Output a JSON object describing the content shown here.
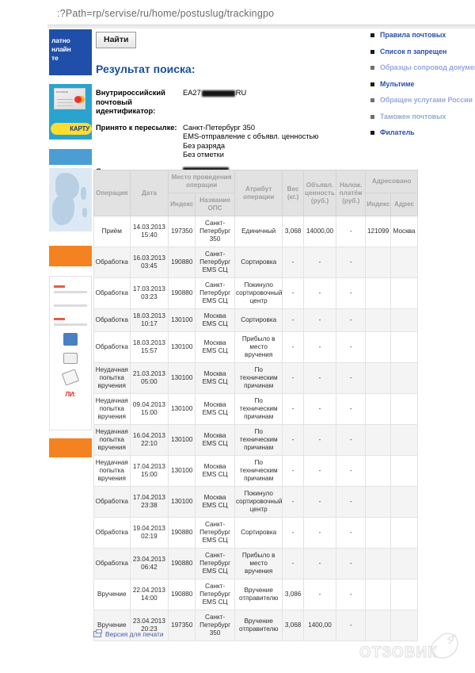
{
  "browser": {
    "url_fragment": ":?Path=rp/servise/ru/home/postuslug/trackingpo"
  },
  "toolbar": {
    "find_label": "Найти"
  },
  "result": {
    "title": "Результат поиска:",
    "id_label_line1": "Внутрироссийский",
    "id_label_line2": "почтовый идентификатор:",
    "id_prefix": "EA27",
    "id_suffix": "RU",
    "accepted_label": "Принято к пересылке:",
    "accepted_values": [
      "Санкт-Петербург 350",
      "EMS-отправление с объявл. ценностью",
      "Без разряда",
      "Без отметки"
    ],
    "sender_label": "Отправитель:"
  },
  "table": {
    "headers": {
      "operation": "Операция",
      "date": "Дата",
      "place_group": "Место проведения операции",
      "index": "Индекс",
      "ops_name": "Название ОПС",
      "attribute": "Атрибут операции",
      "weight": "Вес (кг.)",
      "declared_value": "Объявл. ценность (руб.)",
      "cod": "Налож. платёж (руб.)",
      "addressed_group": "Адресовано",
      "addr_index": "Индекс",
      "addr_address": "Адрес"
    },
    "rows": [
      {
        "operation": "Приём",
        "date": "14.03.2013 15:40",
        "index": "197350",
        "index_link": false,
        "ops": "Санкт-Петербург 350",
        "attribute": "Единичный",
        "weight": "3,068",
        "value": "14000,00",
        "cod": "-",
        "addr_index": "121099",
        "addr": "Москва"
      },
      {
        "operation": "Обработка",
        "date": "16.03.2013 03:45",
        "index": "190880",
        "index_link": false,
        "ops": "Санкт-Петербург EMS СЦ",
        "attribute": "Сортировка",
        "weight": "-",
        "value": "-",
        "cod": "-",
        "addr_index": "",
        "addr": ""
      },
      {
        "operation": "Обработка",
        "date": "17.03.2013 03:23",
        "index": "190880",
        "index_link": false,
        "ops": "Санкт-Петербург EMS СЦ",
        "attribute": "Покинуло сортировочный центр",
        "weight": "-",
        "value": "-",
        "cod": "-",
        "addr_index": "",
        "addr": ""
      },
      {
        "operation": "Обработка",
        "date": "18.03.2013 10:17",
        "index": "130100",
        "index_link": false,
        "ops": "Москва EMS СЦ",
        "attribute": "Сортировка",
        "weight": "-",
        "value": "-",
        "cod": "-",
        "addr_index": "",
        "addr": ""
      },
      {
        "operation": "Обработка",
        "date": "18.03.2013 15:57",
        "index": "130100",
        "index_link": false,
        "ops": "Москва EMS СЦ",
        "attribute": "Прибыло в место вручения",
        "weight": "-",
        "value": "-",
        "cod": "-",
        "addr_index": "",
        "addr": ""
      },
      {
        "operation": "Неудачная попытка вручения",
        "date": "21.03.2013 05:00",
        "index": "130100",
        "index_link": false,
        "ops": "Москва EMS СЦ",
        "attribute": "По техническим причинам",
        "weight": "-",
        "value": "-",
        "cod": "-",
        "addr_index": "",
        "addr": ""
      },
      {
        "operation": "Неудачная попытка вручения",
        "date": "09.04.2013 15:00",
        "index": "130100",
        "index_link": false,
        "ops": "Москва EMS СЦ",
        "attribute": "По техническим причинам",
        "weight": "-",
        "value": "-",
        "cod": "-",
        "addr_index": "",
        "addr": ""
      },
      {
        "operation": "Неудачная попытка вручения",
        "date": "16.04.2013 22:10",
        "index": "130100",
        "index_link": false,
        "ops": "Москва EMS СЦ",
        "attribute": "По техническим причинам",
        "weight": "-",
        "value": "-",
        "cod": "-",
        "addr_index": "",
        "addr": ""
      },
      {
        "operation": "Неудачная попытка вручения",
        "date": "17.04.2013 15:00",
        "index": "130100",
        "index_link": false,
        "ops": "Москва EMS СЦ",
        "attribute": "По техническим причинам",
        "weight": "-",
        "value": "-",
        "cod": "-",
        "addr_index": "",
        "addr": ""
      },
      {
        "operation": "Обработка",
        "date": "17.04.2013 23:38",
        "index": "130100",
        "index_link": false,
        "ops": "Москва EMS СЦ",
        "attribute": "Покинуло сортировочный центр",
        "weight": "-",
        "value": "-",
        "cod": "-",
        "addr_index": "",
        "addr": ""
      },
      {
        "operation": "Обработка",
        "date": "19.04.2013 02:19",
        "index": "190880",
        "index_link": false,
        "ops": "Санкт-Петербург EMS СЦ",
        "attribute": "Сортировка",
        "weight": "-",
        "value": "-",
        "cod": "-",
        "addr_index": "",
        "addr": ""
      },
      {
        "operation": "Обработка",
        "date": "23.04.2013 06:42",
        "index": "190880",
        "index_link": false,
        "ops": "Санкт-Петербург EMS СЦ",
        "attribute": "Прибыло в место вручения",
        "weight": "-",
        "value": "-",
        "cod": "-",
        "addr_index": "",
        "addr": ""
      },
      {
        "operation": "Вручение",
        "date": "22.04.2013 14:00",
        "index": "190880",
        "index_link": true,
        "ops": "Санкт-Петербург EMS СЦ",
        "attribute": "Вручение отправителю",
        "weight": "3,086",
        "value": "-",
        "cod": "-",
        "addr_index": "",
        "addr": ""
      },
      {
        "operation": "Вручение",
        "date": "23.04.2013 20:23",
        "index": "197350",
        "index_link": true,
        "ops": "Санкт-Петербург 350",
        "attribute": "Вручение отправителю",
        "weight": "3,068",
        "value": "1400,00",
        "cod": "-",
        "addr_index": "",
        "addr": ""
      }
    ]
  },
  "footer": {
    "print_label": "Версия для печати"
  },
  "right_links": [
    {
      "text": "Правила почтовых",
      "faded": false
    },
    {
      "text": "Список п запрещен",
      "faded": false
    },
    {
      "text": "Образцы сопровод документ",
      "faded": true
    },
    {
      "text": "Мультиме",
      "faded": false
    },
    {
      "text": "Обращен услугами России",
      "faded": true
    },
    {
      "text": "Таможен почтовых",
      "faded": true
    },
    {
      "text": "Филатель",
      "faded": false
    }
  ],
  "left_ads": {
    "banner_lines": [
      "латно",
      "нлайн",
      "те"
    ],
    "card_cta": "КАРТУ",
    "promo_text": "ЛИ:"
  },
  "watermark": {
    "text": "ОТЗОВИК"
  }
}
